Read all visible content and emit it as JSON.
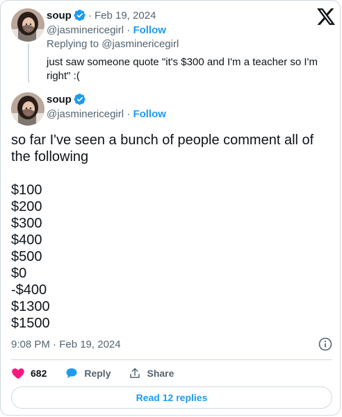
{
  "reply_context": {
    "author_name": "soup",
    "date": "Feb 19, 2024",
    "handle": "@jasminericegirl",
    "follow_label": "Follow",
    "replying_to": "Replying to @jasminericegirl",
    "text": "just saw someone quote \"it's $300 and I'm a teacher so I'm right\" :("
  },
  "main_tweet": {
    "author_name": "soup",
    "handle": "@jasminericegirl",
    "follow_label": "Follow",
    "text_intro": "so far I've seen a bunch of people comment all of the following",
    "amounts": [
      "$100",
      "$200",
      "$300",
      "$400",
      "$500",
      "$0",
      "-$400",
      "$1300",
      "$1500"
    ],
    "timestamp": "9:08 PM · Feb 19, 2024"
  },
  "actions": {
    "like_count": "682",
    "reply_label": "Reply",
    "share_label": "Share"
  },
  "read_replies_label": "Read 12 replies",
  "colors": {
    "accent": "#1d9bf0",
    "like": "#f91880",
    "text": "#0f1419",
    "muted": "#536471",
    "border": "#cfd9de"
  },
  "icons": [
    "x-logo-icon",
    "verified-badge-icon",
    "info-icon",
    "heart-icon",
    "reply-bubble-icon",
    "share-icon"
  ]
}
